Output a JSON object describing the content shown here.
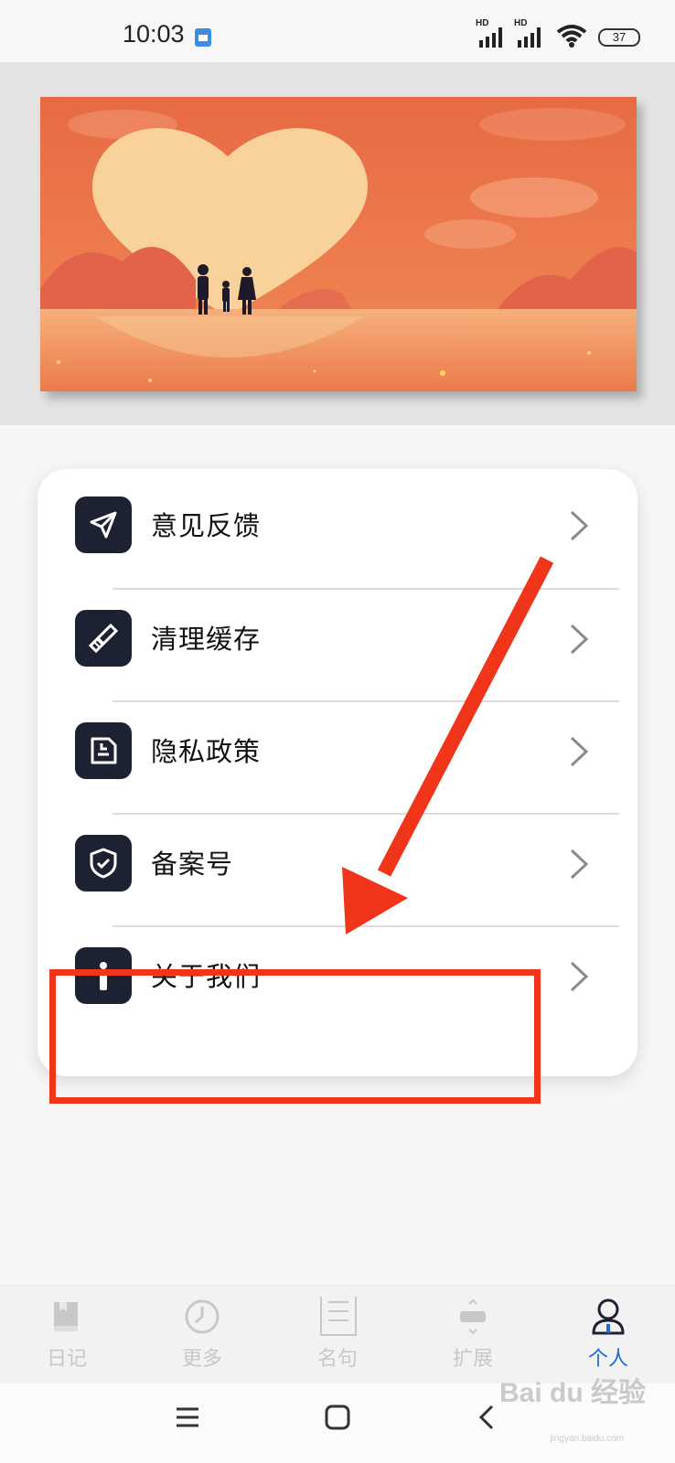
{
  "status_bar": {
    "time": "10:03",
    "signal_1_label": "HD",
    "signal_2_label": "HD",
    "battery": "37",
    "notification_icon": "mi-app-icon"
  },
  "banner": {
    "description_icon": "family-heart-sunset-illustration"
  },
  "menu": {
    "items": [
      {
        "label": "意见反馈",
        "icon": "send-icon"
      },
      {
        "label": "清理缓存",
        "icon": "broom-icon"
      },
      {
        "label": "隐私政策",
        "icon": "document-icon"
      },
      {
        "label": "备案号",
        "icon": "shield-check-icon"
      },
      {
        "label": "关于我们",
        "icon": "info-icon"
      }
    ]
  },
  "bottom_nav": {
    "items": [
      {
        "label": "日记",
        "icon": "book-icon",
        "active": false
      },
      {
        "label": "更多",
        "icon": "clock-icon",
        "active": false
      },
      {
        "label": "名句",
        "icon": "text-page-icon",
        "active": false
      },
      {
        "label": "扩展",
        "icon": "expand-icon",
        "active": false
      },
      {
        "label": "个人",
        "icon": "user-icon",
        "active": true
      }
    ]
  },
  "colors": {
    "accent": "#1d6cd9",
    "icon_bg": "#1d2232",
    "annotation": "#f0351a"
  },
  "watermark": {
    "brand": "Bai du 经验",
    "url": "jingyan.baidu.com"
  }
}
